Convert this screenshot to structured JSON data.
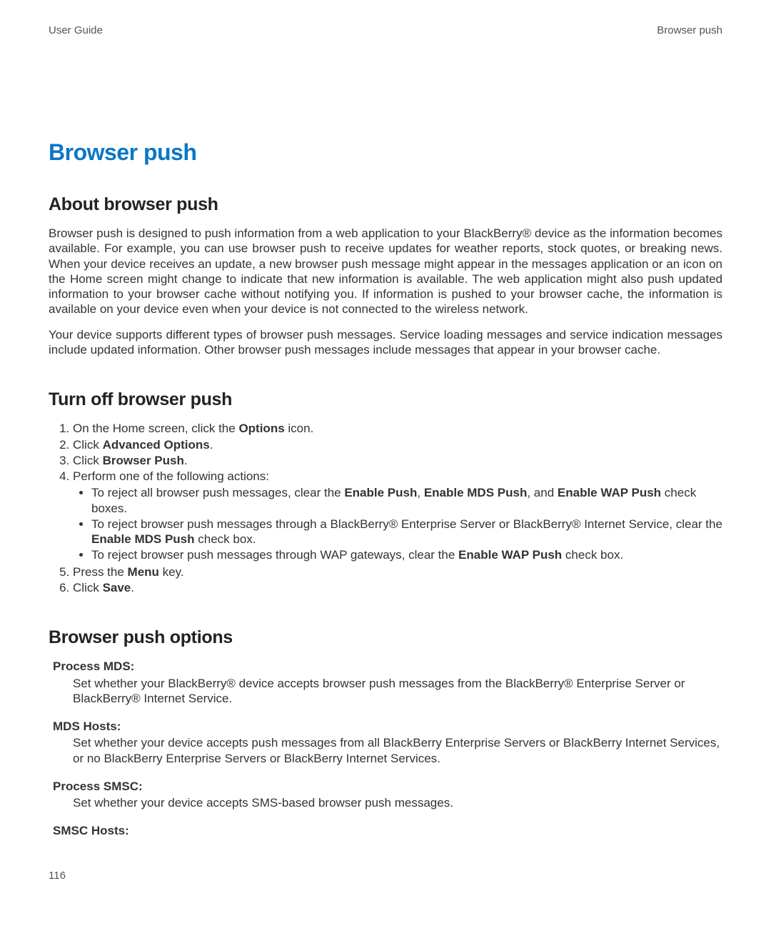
{
  "header": {
    "left": "User Guide",
    "right": "Browser push"
  },
  "chapter_title": "Browser push",
  "s1": {
    "heading": "About browser push",
    "p1": "Browser push is designed to push information from a web application to your BlackBerry® device as the information becomes available. For example, you can use browser push to receive updates for weather reports, stock quotes, or breaking news. When your device receives an update, a new browser push message might appear in the messages application or an icon on the Home screen might change to indicate that new information is available. The web application might also push updated information to your browser cache without notifying you. If information is pushed to your browser cache, the information is available on your device even when your device is not connected to the wireless network.",
    "p2": "Your device supports different types of browser push messages. Service loading messages and service indication messages include updated information. Other browser push messages include messages that appear in your browser cache."
  },
  "s2": {
    "heading": "Turn off browser push",
    "step1_a": "On the Home screen, click the ",
    "step1_b": "Options",
    "step1_c": " icon.",
    "step2_a": "Click ",
    "step2_b": "Advanced Options",
    "step2_c": ".",
    "step3_a": "Click ",
    "step3_b": "Browser Push",
    "step3_c": ".",
    "step4": "Perform one of the following actions:",
    "step4_b1_a": "To reject all browser push messages, clear the ",
    "step4_b1_b": "Enable Push",
    "step4_b1_c": ", ",
    "step4_b1_d": "Enable MDS Push",
    "step4_b1_e": ", and ",
    "step4_b1_f": "Enable WAP Push",
    "step4_b1_g": " check boxes.",
    "step4_b2_a": "To reject browser push messages through a BlackBerry® Enterprise Server or BlackBerry® Internet Service, clear the ",
    "step4_b2_b": "Enable MDS Push",
    "step4_b2_c": " check box.",
    "step4_b3_a": "To reject browser push messages through WAP gateways, clear the ",
    "step4_b3_b": "Enable WAP Push",
    "step4_b3_c": " check box.",
    "step5_a": "Press the ",
    "step5_b": "Menu",
    "step5_c": " key.",
    "step6_a": "Click ",
    "step6_b": "Save",
    "step6_c": "."
  },
  "s3": {
    "heading": "Browser push options",
    "t1": "Process MDS:",
    "d1": "Set whether your BlackBerry® device accepts browser push messages from the BlackBerry® Enterprise Server or BlackBerry® Internet Service.",
    "t2": "MDS Hosts:",
    "d2": "Set whether your device accepts push messages from all BlackBerry Enterprise Servers or BlackBerry Internet Services, or no BlackBerry Enterprise Servers or BlackBerry Internet Services.",
    "t3": "Process SMSC:",
    "d3": "Set whether your device accepts SMS-based browser push messages.",
    "t4": "SMSC Hosts:"
  },
  "page_number": "116"
}
